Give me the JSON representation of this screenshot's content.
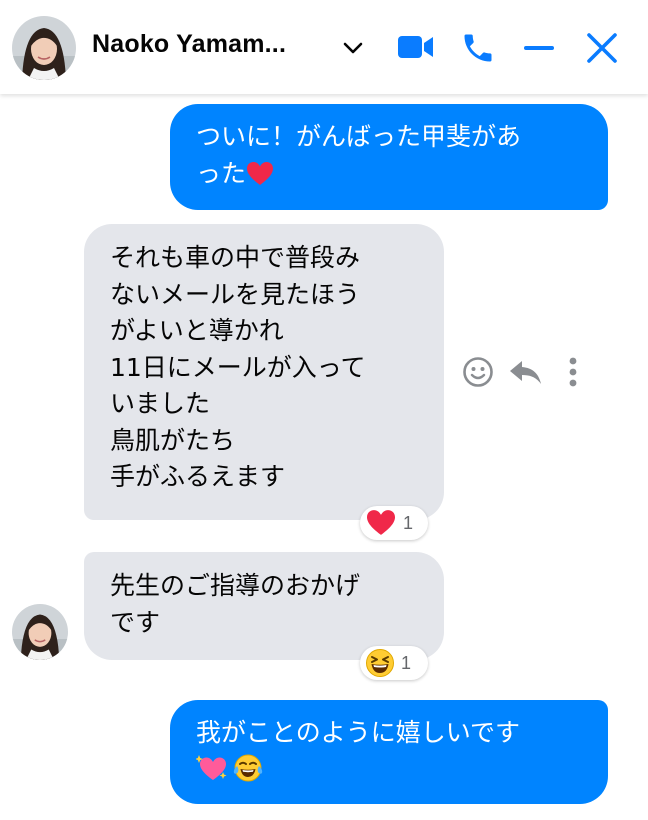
{
  "header": {
    "contact_name": "Naoko Yamam...",
    "icons": [
      "chevron-down-icon",
      "video-call-icon",
      "phone-icon",
      "minimize-icon",
      "close-icon"
    ]
  },
  "messages": [
    {
      "direction": "outgoing",
      "text": "ついに！がんばった甲斐があ\nった",
      "trailing_emoji": "red-heart"
    },
    {
      "direction": "incoming",
      "text": "それも車の中で普段み\nないメールを見たほう\nがよいと導かれ\n11日にメールが入って\nいました\n鳥肌がたち\n手がふるえます",
      "reaction": {
        "emoji": "red-heart",
        "count": "1"
      }
    },
    {
      "direction": "incoming",
      "text": "先生のご指導のおかげ\nです",
      "reaction": {
        "emoji": "laughing-face",
        "count": "1"
      }
    },
    {
      "direction": "outgoing",
      "text": "我がことのように嬉しいです",
      "trailing_emojis": [
        "sparkling-heart",
        "tears-of-joy-face"
      ]
    }
  ],
  "colors": {
    "outgoing_bubble": "#0084ff",
    "incoming_bubble": "#e4e6eb",
    "accent": "#0a7cff",
    "reaction_count": "#65676b"
  }
}
